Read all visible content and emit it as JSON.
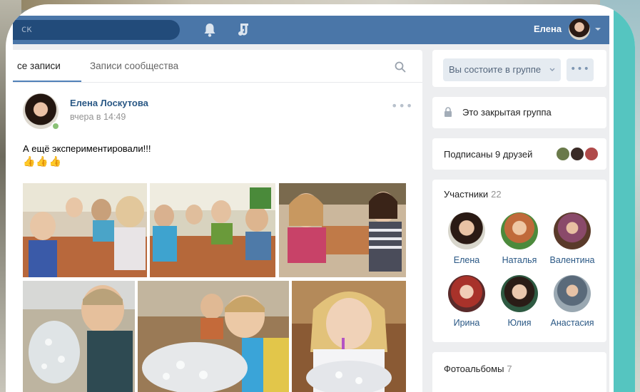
{
  "topbar": {
    "search_placeholder": "Поиск",
    "search_visible": "ск",
    "user_name": "Елена"
  },
  "wall": {
    "tabs": [
      {
        "label": "Все записи",
        "visible": "се записи",
        "active": true
      },
      {
        "label": "Записи сообщества",
        "active": false
      }
    ],
    "post": {
      "author": "Елена Лоскутова",
      "time": "вчера в 14:49",
      "text": "А ещё экспериментировали!!!",
      "emoji": "👍👍👍",
      "more": "•••"
    }
  },
  "sidebar": {
    "membership_button": "Вы состоите в группе",
    "more_button": "•••",
    "closed_group": "Это закрытая группа",
    "friends_subscribed": "Подписаны 9 друзей",
    "members_title": "Участники",
    "members_count": "22",
    "members": [
      {
        "name": "Елена",
        "color": "#3a2a22"
      },
      {
        "name": "Наталья",
        "color": "#c06a3a"
      },
      {
        "name": "Валентина",
        "color": "#8a4a6a"
      },
      {
        "name": "Ирина",
        "color": "#a8322a"
      },
      {
        "name": "Юлия",
        "color": "#2e5a42"
      },
      {
        "name": "Анастасия",
        "color": "#5a6a7a"
      }
    ],
    "albums_title": "Фотоальбомы",
    "albums_count": "7"
  },
  "colors": {
    "header_bg": "#4a76a8",
    "link": "#2a5885",
    "page_bg": "#edeef0",
    "accent_teal": "#37bbb5"
  }
}
